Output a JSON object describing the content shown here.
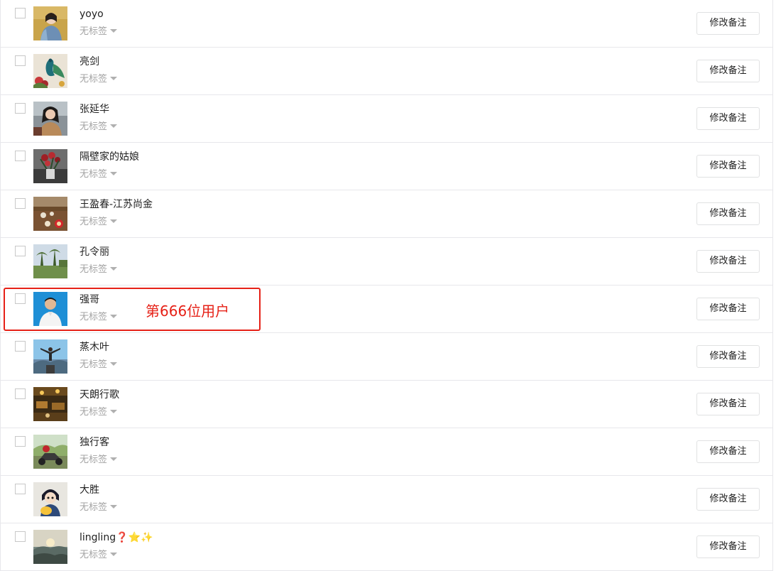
{
  "users": [
    {
      "name": "yoyo",
      "tag": "无标签",
      "button": "修改备注",
      "avatar": "portrait-woman-photo"
    },
    {
      "name": "亮剑",
      "tag": "无标签",
      "button": "修改备注",
      "avatar": "peacock-painting-photo"
    },
    {
      "name": "张延华",
      "tag": "无标签",
      "button": "修改备注",
      "avatar": "woman-portrait-photo"
    },
    {
      "name": "隔壁家的姑娘",
      "tag": "无标签",
      "button": "修改备注",
      "avatar": "flowers-photo"
    },
    {
      "name": "王盈春-江苏尚金",
      "tag": "无标签",
      "button": "修改备注",
      "avatar": "tea-table-photo"
    },
    {
      "name": "孔令丽",
      "tag": "无标签",
      "button": "修改备注",
      "avatar": "palm-trees-photo"
    },
    {
      "name": "强哥",
      "tag": "无标签",
      "button": "修改备注",
      "avatar": "man-blue-background-photo"
    },
    {
      "name": "蒸木叶",
      "tag": "无标签",
      "button": "修改备注",
      "avatar": "man-mountain-photo"
    },
    {
      "name": "天朗行歌",
      "tag": "无标签",
      "button": "修改备注",
      "avatar": "restaurant-interior-photo"
    },
    {
      "name": "独行客",
      "tag": "无标签",
      "button": "修改备注",
      "avatar": "motorbike-rider-photo"
    },
    {
      "name": "大胜",
      "tag": "无标签",
      "button": "修改备注",
      "avatar": "cartoon-boy-photo"
    },
    {
      "name": "lingling",
      "name_suffix_emoji": "❓⭐✨",
      "tag": "无标签",
      "button": "修改备注",
      "avatar": "sunrise-mountain-photo"
    }
  ],
  "annotation": {
    "text": "第666位用户",
    "color": "#e62117"
  },
  "colors": {
    "border": "#e7e7eb",
    "tag_text": "#a3a3a3"
  }
}
